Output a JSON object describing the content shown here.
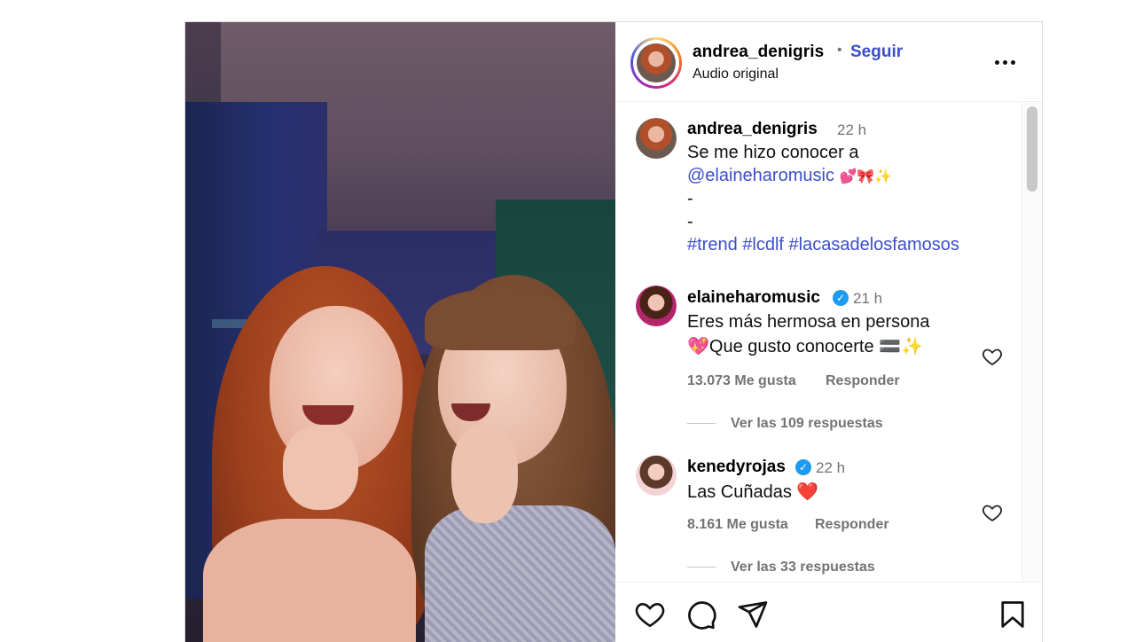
{
  "header": {
    "username": "andrea_denigris",
    "separator": "•",
    "follow_label": "Seguir",
    "subtitle": "Audio original"
  },
  "caption": {
    "username": "andrea_denigris",
    "time": "22 h",
    "line1": "Se me hizo conocer a",
    "mention": "@elaineharomusic",
    "emojis": "💕🎀✨",
    "dash1": "-",
    "dash2": "-",
    "hashtags": "#trend #lcdlf #lacasadelosfamosos"
  },
  "comments": [
    {
      "username": "elaineharomusic",
      "time": "21 h",
      "line1": "Eres más hermosa en persona",
      "line2": "💖Que gusto conocerte 🟰✨",
      "likes": "13.073 Me gusta",
      "reply_label": "Responder",
      "view_replies": "Ver las 109 respuestas"
    },
    {
      "username": "kenedyrojas",
      "time": "22 h",
      "line1": "Las Cuñadas ❤️",
      "likes": "8.161 Me gusta",
      "reply_label": "Responder",
      "view_replies": "Ver las 33 respuestas"
    }
  ],
  "icons": {
    "verified": "✓",
    "like": "heart-icon",
    "comment": "comment-icon",
    "share": "share-icon",
    "save": "bookmark-icon",
    "more": "more-options-icon"
  },
  "colors": {
    "link": "#3b4ec8",
    "muted": "#737373",
    "verified": "#1d9bf0"
  }
}
